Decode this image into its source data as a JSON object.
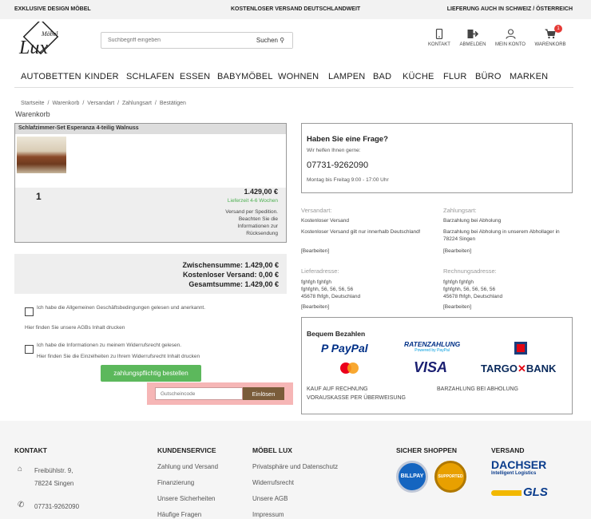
{
  "topbar": {
    "left": "EXKLUSIVE DESIGN MÖBEL",
    "center": "KOSTENLOSER VERSAND DEUTSCHLANDWEIT",
    "right": "LIEFERUNG AUCH IN SCHWEIZ / ÖSTERREICH"
  },
  "header": {
    "logo_text_big": "Lux",
    "logo_text_small": "Möbel",
    "search_placeholder": "Suchbegriff eingeben",
    "search_button": "Suchen",
    "icons": [
      {
        "label": "KONTAKT",
        "icon": "phone-icon"
      },
      {
        "label": "ABMELDEN",
        "icon": "logout-icon"
      },
      {
        "label": "MEIN KONTO",
        "icon": "user-icon"
      },
      {
        "label": "WARENKORB",
        "icon": "cart-icon"
      }
    ],
    "cart_badge": "1"
  },
  "nav": [
    "AUTOBETTEN",
    "KINDER",
    "SCHLAFEN",
    "ESSEN",
    "BABYMÖBEL",
    "WOHNEN",
    "LAMPEN",
    "BAD",
    "KÜCHE",
    "FLUR",
    "BÜRO",
    "MARKEN"
  ],
  "breadcrumb": [
    "Startseite",
    "/",
    "Warenkorb",
    "/",
    "Versandart",
    "/",
    "Zahlungsart",
    "/",
    "Bestätigen"
  ],
  "page_title": "Warenkorb",
  "cart": {
    "product_name": "Schlafzimmer-Set Esperanza 4-teilig Walnuss",
    "quantity": "1",
    "price": "1.429,00 €",
    "availability": "Lieferzeit 4-6 Wochen",
    "shipping_note": "Versand per Spedition. Beachten Sie die Informationen zur Rücksendung"
  },
  "totals": {
    "subtotal": "Zwischensumme: 1.429,00 €",
    "shipping": "Kostenloser Versand: 0,00 €",
    "total": "Gesamtsumme: 1.429,00 €"
  },
  "terms": {
    "agb_label": "Ich habe die Allgemeinen Geschäftsbedingungen gelesen und anerkannt.",
    "agb_hint": "Hier finden Sie unsere AGBs Inhalt drucken",
    "widerruf_label": "Ich habe die Informationen zu meinem Widerrufsrecht gelesen.",
    "widerruf_hint": "Hier finden Sie die Einzelheiten zu Ihrem Widerrufsrecht Inhalt drucken"
  },
  "order_button": "zahlungspflichtig bestellen",
  "coupon": {
    "placeholder": "Gutscheincode",
    "button": "Einlösen"
  },
  "question_box": {
    "title": "Haben Sie eine Frage?",
    "subtitle": "Wir helfen Ihnen gerne:",
    "phone": "07731-9262090",
    "hours": "Montag bis Freitag 9:00 - 17:00 Uhr"
  },
  "order_info": {
    "versandart_head": "Versandart:",
    "versandart_1": "Kostenloser Versand",
    "versandart_2": "Kostenloser Versand gilt nur innerhalb Deutschland!",
    "versandart_edit": "[Bearbeiten]",
    "zahlungsart_head": "Zahlungsart:",
    "zahlungsart_1": "Barzahlung bei Abholung",
    "zahlungsart_2": "Barzahlung bei Abholung in unserem Abhollager in 78224 Singen",
    "zahlungsart_edit": "[Bearbeiten]",
    "liefer_head": "Lieferadresse:",
    "liefer_1": "fghfgh fghfgh",
    "liefer_2": "fghfghh, 56, 56, 56, 56",
    "liefer_3": "45678 fhfgh, Deutschland",
    "liefer_edit": "[Bearbeiten]",
    "rechnung_head": "Rechnungsadresse:",
    "rechnung_1": "fghfgh fghfgh",
    "rechnung_2": "fghfghh, 56, 56, 56, 56",
    "rechnung_3": "45678 fhfgh, Deutschland",
    "rechnung_edit": "[Bearbeiten]"
  },
  "payment_box": {
    "title": "Bequem Bezahlen",
    "paypal": "PayPal",
    "ratenzahlung": "RATENZAHLUNG",
    "ratenzahlung_sub": "Powered by PayPal",
    "visa": "VISA",
    "targo": "TARGO",
    "bank": "BANK",
    "kauf": "KAUF AUF RECHNUNG",
    "vorkasse": "VORAUSKASSE PER ÜBERWEISUNG",
    "barzahlung": "BARZAHLUNG BEI ABHOLUNG"
  },
  "footer": {
    "kontakt_head": "KONTAKT",
    "address_1": "Freibühlstr. 9,",
    "address_2": "78224 Singen",
    "phone": "07731-9262090",
    "kundenservice_head": "KUNDENSERVICE",
    "kundenservice": [
      "Zahlung und Versand",
      "Finanzierung",
      "Unsere Sicherheiten",
      "Häufige Fragen"
    ],
    "moebellux_head": "MÖBEL LUX",
    "moebellux": [
      "Privatsphäre und Datenschutz",
      "Widerrufsrecht",
      "Unsere AGB",
      "Impressum"
    ],
    "sicher_head": "SICHER SHOPPEN",
    "versand_head": "VERSAND",
    "dachser": "DACHSER",
    "dachser_sub": "Intelligent Logistics",
    "gls": "GLS",
    "billpay": "BILLPAY",
    "paypal_badge": "SUPPORTED"
  },
  "colors": {
    "green": "#5cb85c",
    "coupon_highlight": "#f6b6b6",
    "coupon_button": "#7a5c3a",
    "paypal_blue": "#003087",
    "paypal_light": "#009cde"
  }
}
